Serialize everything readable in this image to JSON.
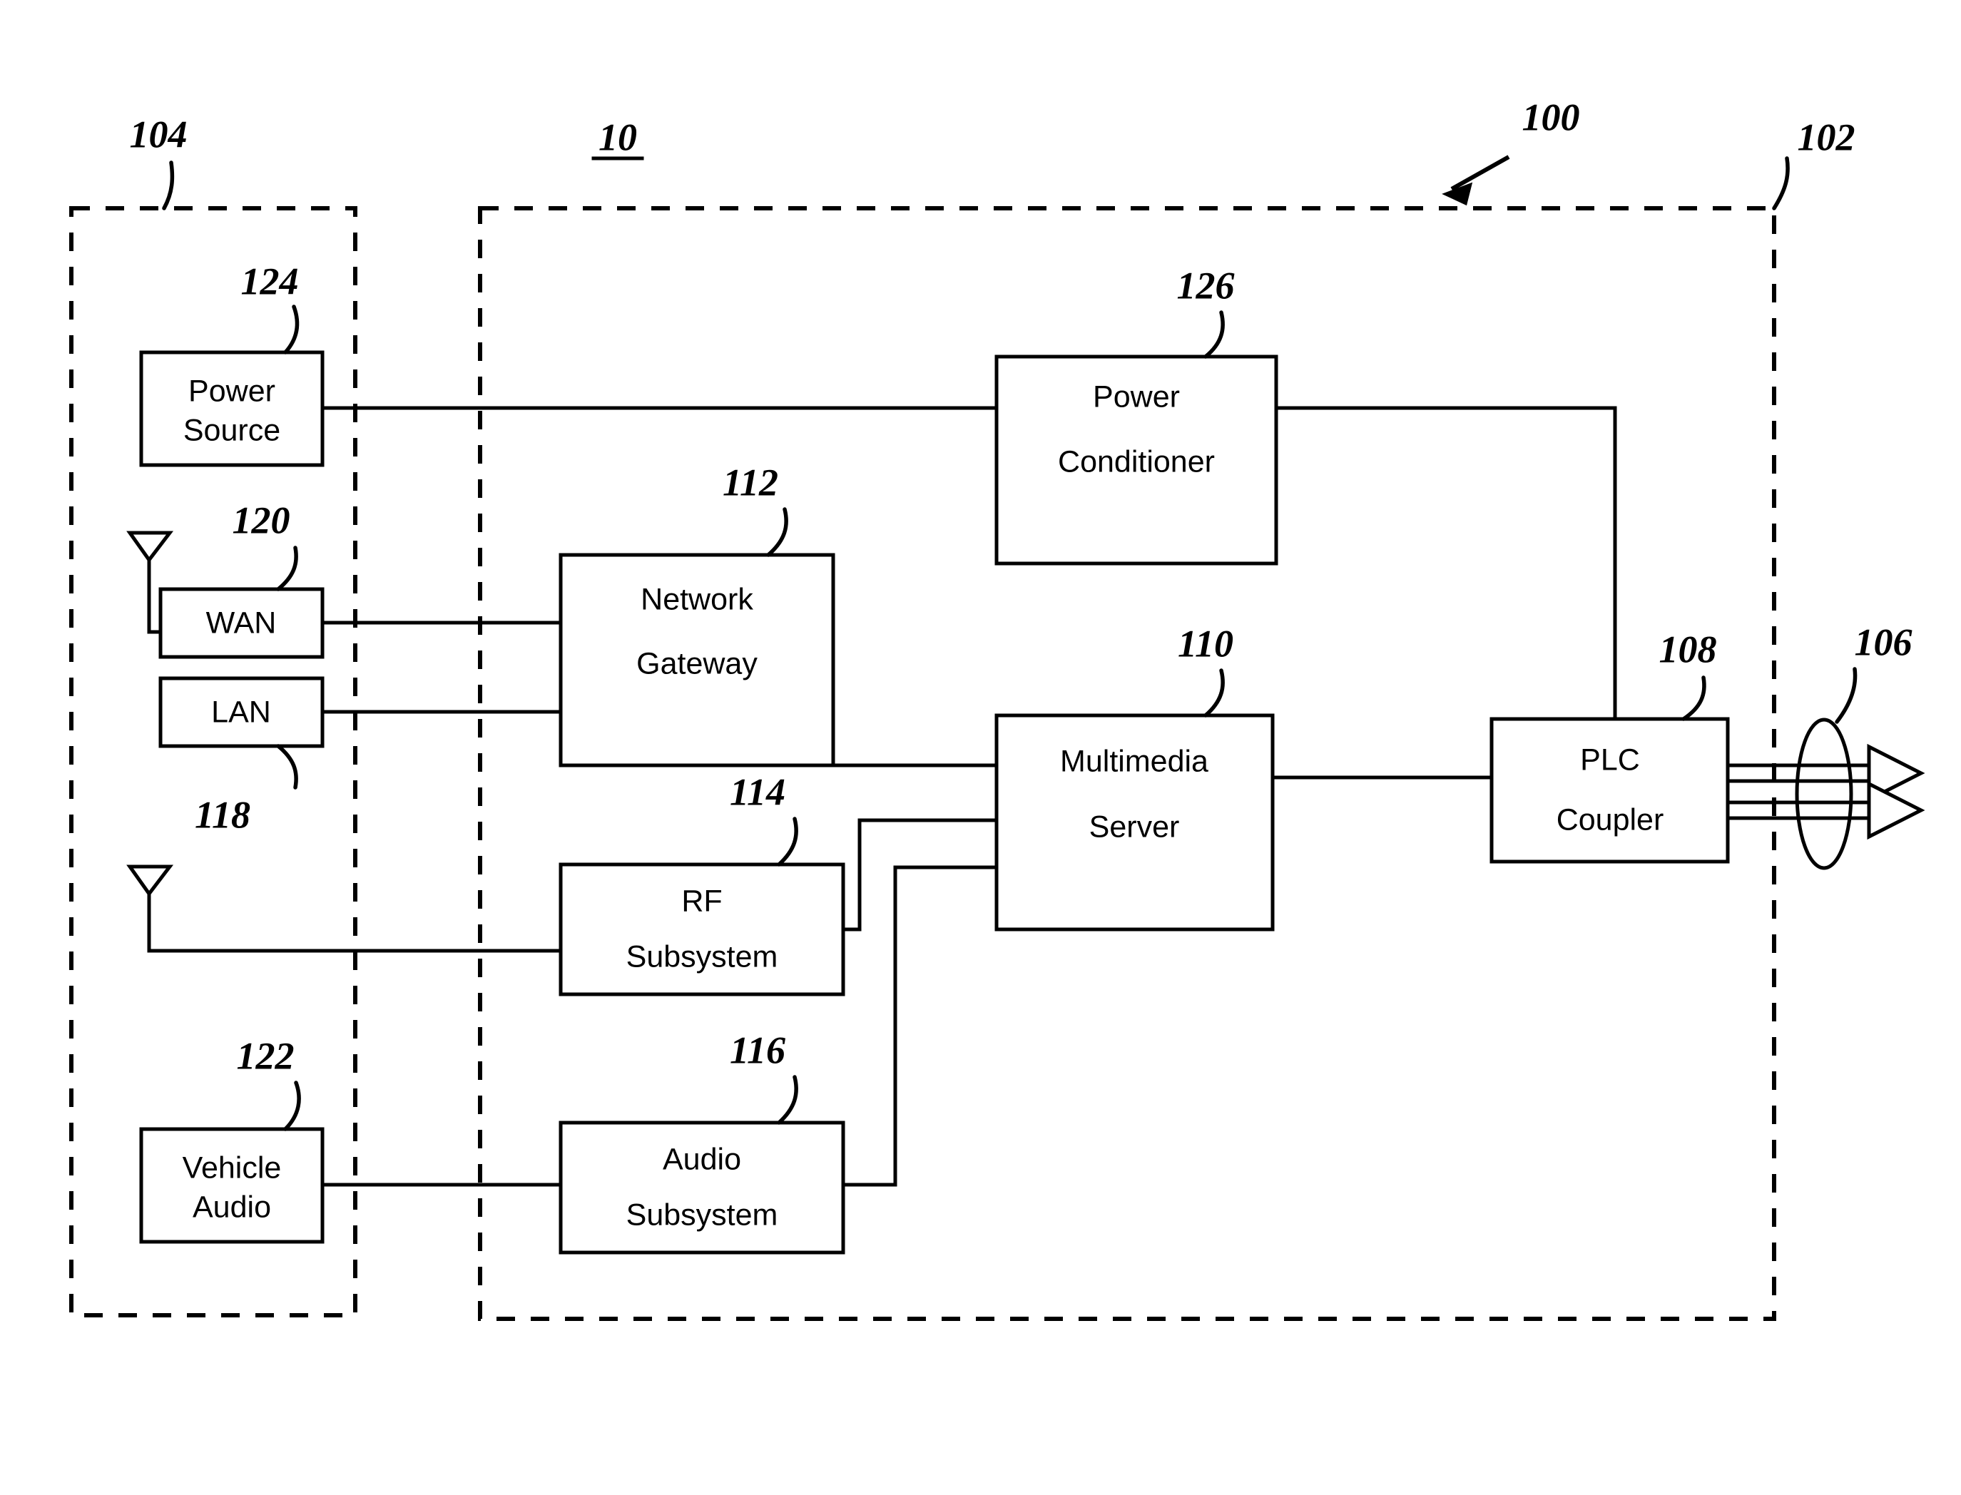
{
  "figure": {
    "title_ref": "10",
    "system_ref": "100",
    "vehicle_boundary_ref": "102",
    "external_boundary_ref": "104",
    "powerline_bundle_ref": "106"
  },
  "blocks": [
    {
      "id": "power-source",
      "ref": "124",
      "line1": "Power",
      "line2": "Source"
    },
    {
      "id": "wan",
      "ref": "120",
      "line1": "WAN",
      "line2": ""
    },
    {
      "id": "lan",
      "ref": "118",
      "line1": "LAN",
      "line2": ""
    },
    {
      "id": "vehicle-audio",
      "ref": "122",
      "line1": "Vehicle",
      "line2": "Audio"
    },
    {
      "id": "network-gateway",
      "ref": "112",
      "line1": "Network",
      "line2": "Gateway"
    },
    {
      "id": "rf-subsystem",
      "ref": "114",
      "line1": "RF",
      "line2": "Subsystem"
    },
    {
      "id": "audio-subsystem",
      "ref": "116",
      "line1": "Audio",
      "line2": "Subsystem"
    },
    {
      "id": "power-conditioner",
      "ref": "126",
      "line1": "Power",
      "line2": "Conditioner"
    },
    {
      "id": "multimedia-server",
      "ref": "110",
      "line1": "Multimedia",
      "line2": "Server"
    },
    {
      "id": "plc-coupler",
      "ref": "108",
      "line1": "PLC",
      "line2": "Coupler"
    }
  ],
  "labels": {
    "ref_10": "10",
    "ref_100": "100",
    "ref_102": "102",
    "ref_104": "104",
    "ref_106": "106",
    "ref_108": "108",
    "ref_110": "110",
    "ref_112": "112",
    "ref_114": "114",
    "ref_116": "116",
    "ref_118": "118",
    "ref_120": "120",
    "ref_122": "122",
    "ref_124": "124",
    "ref_126": "126",
    "power_source_l1": "Power",
    "power_source_l2": "Source",
    "wan": "WAN",
    "lan": "LAN",
    "vehicle_audio_l1": "Vehicle",
    "vehicle_audio_l2": "Audio",
    "network_gateway_l1": "Network",
    "network_gateway_l2": "Gateway",
    "rf_subsystem_l1": "RF",
    "rf_subsystem_l2": "Subsystem",
    "audio_subsystem_l1": "Audio",
    "audio_subsystem_l2": "Subsystem",
    "power_conditioner_l1": "Power",
    "power_conditioner_l2": "Conditioner",
    "multimedia_server_l1": "Multimedia",
    "multimedia_server_l2": "Server",
    "plc_coupler_l1": "PLC",
    "plc_coupler_l2": "Coupler"
  },
  "colors": {
    "ink": "#000000",
    "paper": "#ffffff"
  }
}
